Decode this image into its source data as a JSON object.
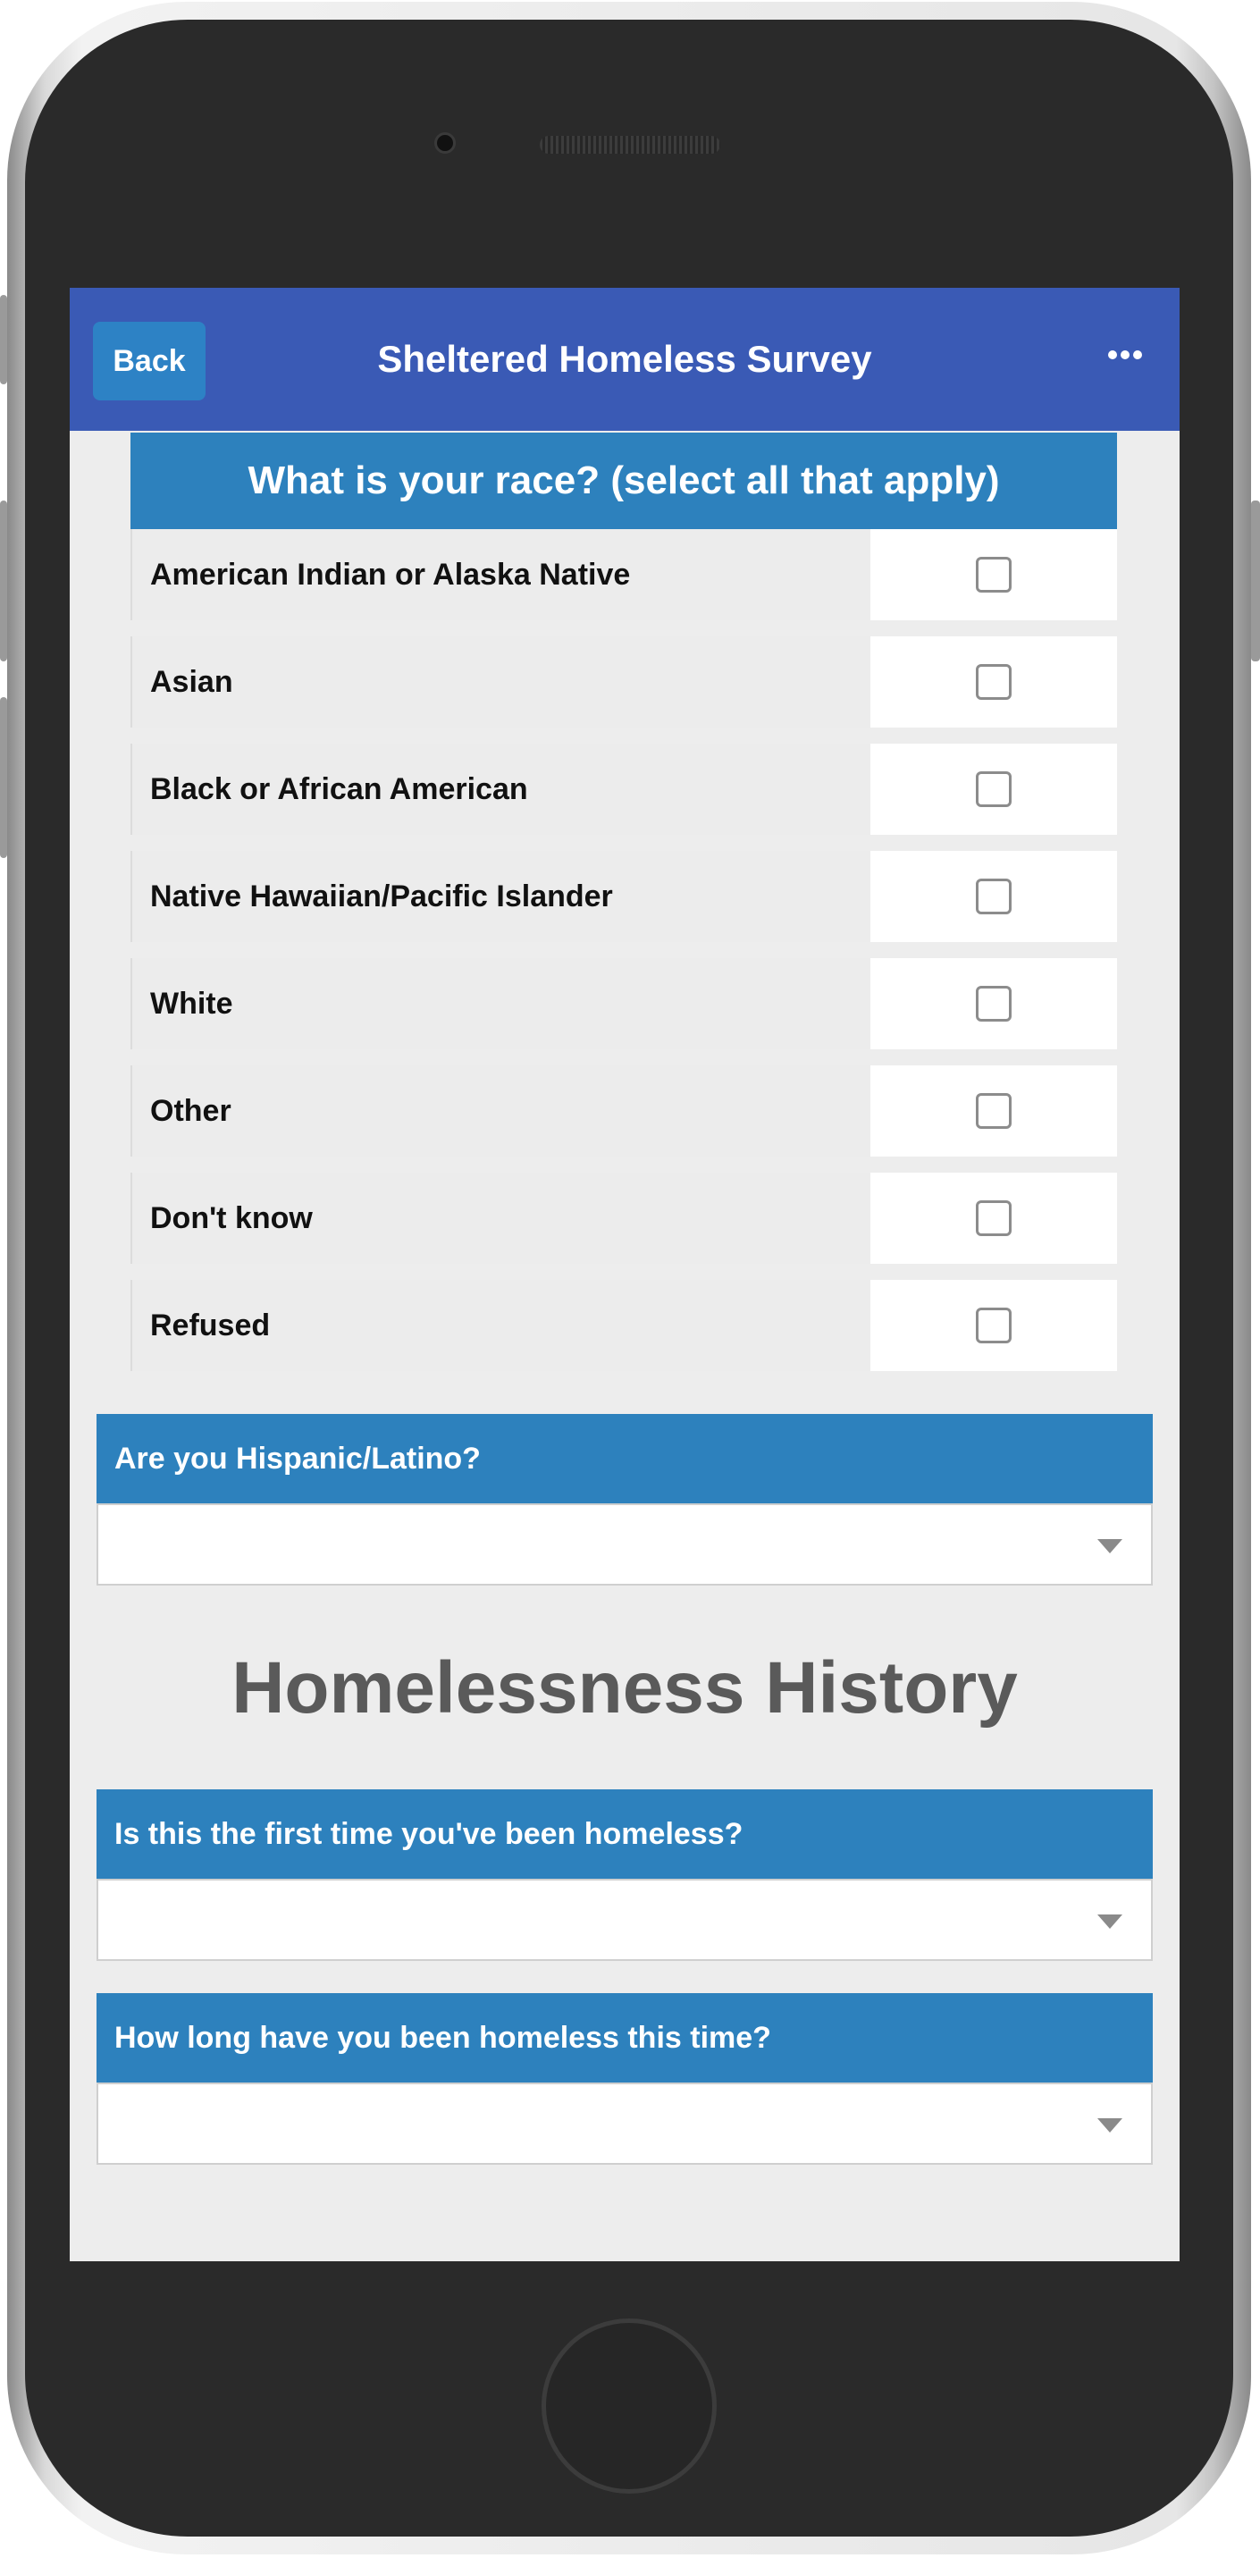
{
  "header": {
    "back_label": "Back",
    "title": "Sheltered Homeless Survey",
    "more_icon": "more-horizontal-icon"
  },
  "race": {
    "question": "What is your race? (select all that apply)",
    "options": [
      {
        "label": "American Indian or Alaska Native",
        "checked": false
      },
      {
        "label": "Asian",
        "checked": false
      },
      {
        "label": "Black or African American",
        "checked": false
      },
      {
        "label": "Native Hawaiian/Pacific Islander",
        "checked": false
      },
      {
        "label": "White",
        "checked": false
      },
      {
        "label": "Other",
        "checked": false
      },
      {
        "label": "Don't know",
        "checked": false
      },
      {
        "label": "Refused",
        "checked": false
      }
    ]
  },
  "hispanic": {
    "question": "Are you Hispanic/Latino?",
    "value": ""
  },
  "section": {
    "title": "Homelessness History"
  },
  "first_time": {
    "question": "Is this the first time you've been homeless?",
    "value": ""
  },
  "how_long": {
    "question": "How long have you been homeless this time?",
    "value": ""
  },
  "colors": {
    "header_bg": "#3a5ab5",
    "question_bg": "#2d81bd",
    "back_button_bg": "#2d82c5",
    "screen_bg": "#ededed"
  }
}
